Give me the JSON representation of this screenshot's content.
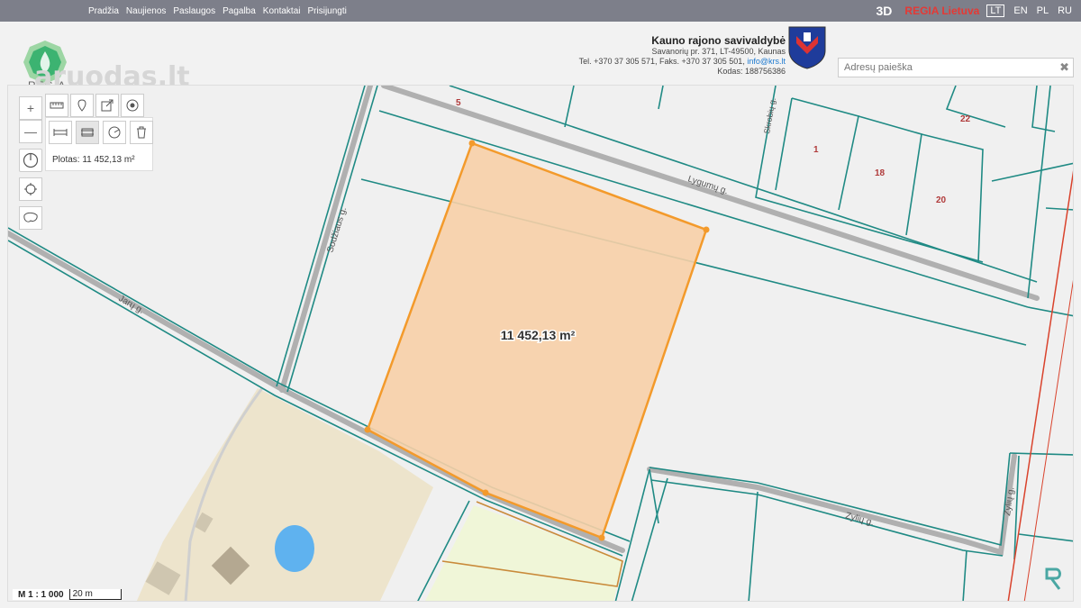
{
  "nav": [
    "Pradžia",
    "Naujienos",
    "Paslaugos",
    "Pagalba",
    "Kontaktai",
    "Prisijungti"
  ],
  "topbar": {
    "btn3d": "3D",
    "regia": "REGIA Lietuva",
    "languages": [
      "LT",
      "EN",
      "PL",
      "RU"
    ]
  },
  "logo": {
    "text": "REGIA"
  },
  "watermark": "aruodas.lt",
  "municipality": {
    "name": "Kauno rajono savivaldybė",
    "address": "Savanorių pr. 371, LT-49500, Kaunas",
    "phone": "Tel. +370 37 305 571, Faks. +370 37 305 501,",
    "email": "info@krs.lt",
    "code": "Kodas: 188756386"
  },
  "search": {
    "placeholder": "Adresų paieška",
    "clear": "✖"
  },
  "tools": {
    "plotas": "Plotas: 11 452,13 m²"
  },
  "map": {
    "area_label": "11 452,13 m²",
    "streets": {
      "jaru": "Jarų g.",
      "sodziaus": "Sodžiaus g.",
      "lygumu": "Lygumų g.",
      "zyliu1": "Zylių g.",
      "zyliu2": "Zylių g.",
      "skrobiu": "Skrobių g."
    },
    "parcel_numbers": [
      "5",
      "22",
      "1",
      "18",
      "20"
    ]
  },
  "scale": {
    "ratio": "M 1 : 1 000",
    "bar": "20 m"
  },
  "colors": {
    "parcel_line": "#1f8a84",
    "measure": "#f39a2b",
    "measure_fill": "#f7cfa7",
    "road": "#b0b0b0",
    "pond": "#5fb2ef",
    "red_line": "#d9422c"
  }
}
